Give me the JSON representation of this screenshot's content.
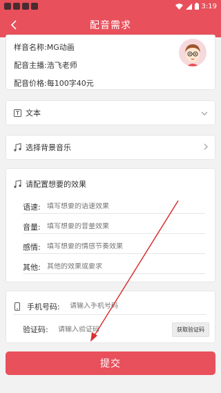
{
  "status_bar": {
    "time": "3:19"
  },
  "header": {
    "title": "配音需求"
  },
  "info": {
    "sample_name_label": "样音名称:",
    "sample_name_value": "MG动画",
    "host_label": "配音主播:",
    "host_value": "浩飞老师",
    "price_label": "配音价格:",
    "price_value": "每100字40元"
  },
  "text_row": {
    "label": "文本"
  },
  "music_row": {
    "label": "选择背景音乐"
  },
  "effects": {
    "title": "请配置想要的效果",
    "items": [
      {
        "label": "语速:",
        "placeholder": "填写想要的语速效果"
      },
      {
        "label": "音量:",
        "placeholder": "填写想要的音量效果"
      },
      {
        "label": "感情:",
        "placeholder": "填写想要的情感节奏效果"
      },
      {
        "label": "其他:",
        "placeholder": "其他的效果或要求"
      }
    ]
  },
  "contact": {
    "phone_label": "手机号码:",
    "phone_placeholder": "请输入手机号码",
    "code_label": "验证码:",
    "code_placeholder": "请输入验证码",
    "code_button": "获取验证码"
  },
  "submit": {
    "label": "提交"
  },
  "colors": {
    "accent": "#e8505b",
    "background": "#f2f2f2"
  }
}
